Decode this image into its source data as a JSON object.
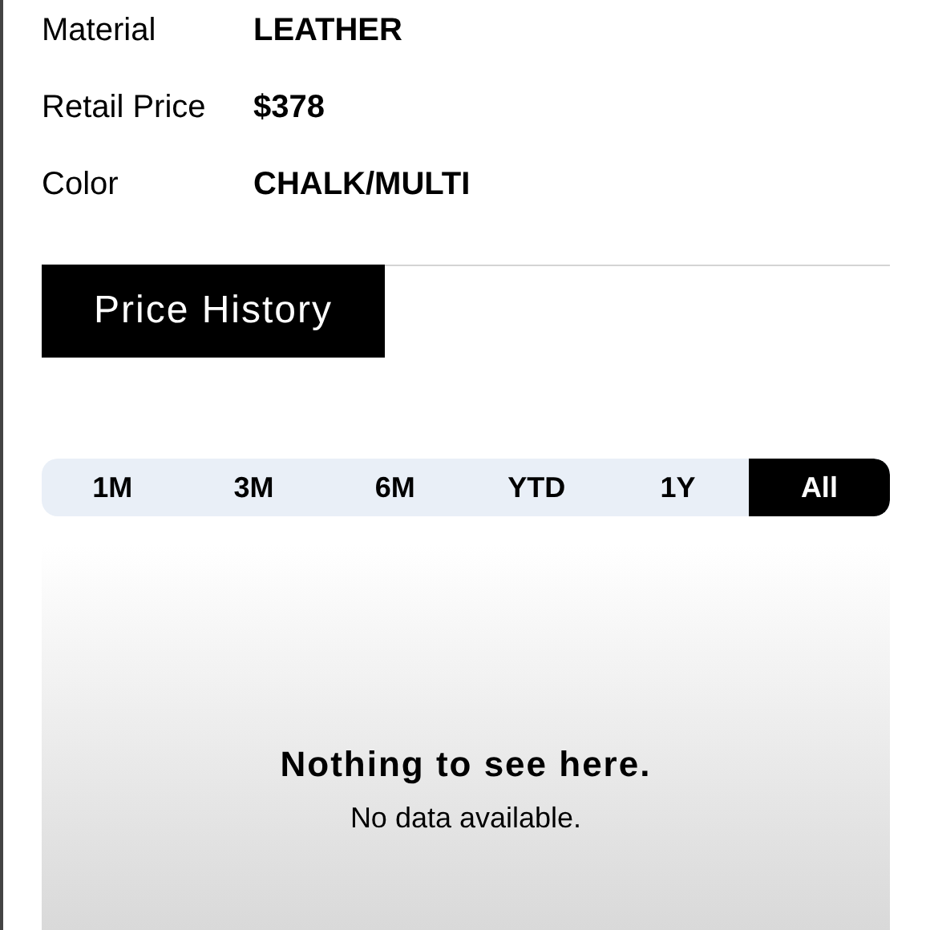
{
  "details": [
    {
      "label": "Material",
      "value": "LEATHER"
    },
    {
      "label": "Retail Price",
      "value": "$378"
    },
    {
      "label": "Color",
      "value": "CHALK/MULTI"
    }
  ],
  "section_title": "Price History",
  "ranges": [
    {
      "label": "1M",
      "selected": false
    },
    {
      "label": "3M",
      "selected": false
    },
    {
      "label": "6M",
      "selected": false
    },
    {
      "label": "YTD",
      "selected": false
    },
    {
      "label": "1Y",
      "selected": false
    },
    {
      "label": "All",
      "selected": true
    }
  ],
  "empty_state": {
    "title": "Nothing to see here.",
    "message": "No data available."
  }
}
